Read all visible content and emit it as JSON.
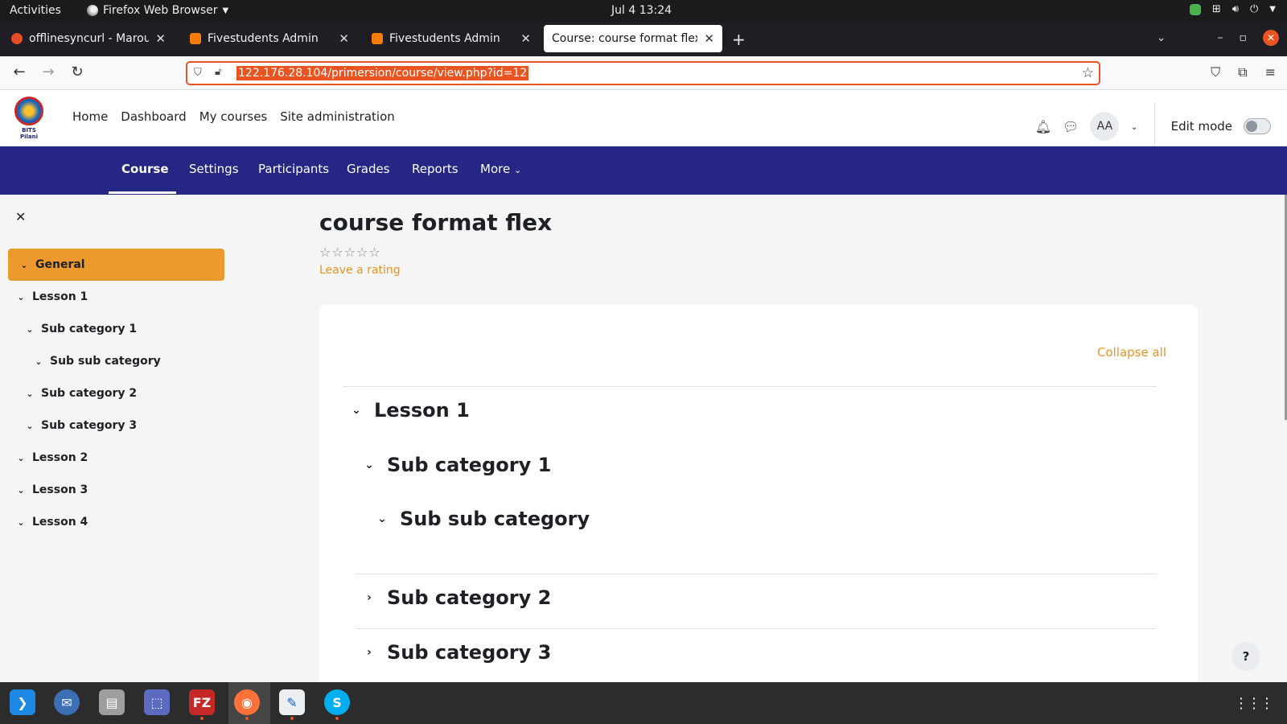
{
  "system": {
    "activities": "Activities",
    "app_name": "Firefox Web Browser",
    "clock": "Jul 4  13:24"
  },
  "browser": {
    "tabs": [
      {
        "label": "offlinesyncurl - Marouane",
        "favicon_color": "#e34c26"
      },
      {
        "label": "Fivestudents Admin",
        "favicon_color": "#f57c00"
      },
      {
        "label": "Fivestudents Admin",
        "favicon_color": "#f57c00"
      },
      {
        "label": "Course: course format flex",
        "favicon_color": "#ffffff"
      }
    ],
    "url": "122.176.28.104/primersion/course/view.php?id=12"
  },
  "moodle": {
    "logo_text": "BITS Pilani",
    "primary_nav": [
      "Home",
      "Dashboard",
      "My courses",
      "Site administration"
    ],
    "avatar_initials": "AA",
    "edit_mode_label": "Edit mode",
    "secondary_nav": [
      "Course",
      "Settings",
      "Participants",
      "Grades",
      "Reports",
      "More"
    ],
    "accent_color": "#ec9a2d",
    "nav_color": "#262685"
  },
  "drawer": {
    "items": [
      {
        "label": "General",
        "active": true
      },
      {
        "label": "Lesson 1"
      },
      {
        "label": "Sub category 1"
      },
      {
        "label": "Sub sub category"
      },
      {
        "label": "Sub category 2"
      },
      {
        "label": "Sub category 3"
      },
      {
        "label": "Lesson 2"
      },
      {
        "label": "Lesson 3"
      },
      {
        "label": "Lesson 4"
      }
    ]
  },
  "course": {
    "title": "course format flex",
    "stars": "☆☆☆☆☆",
    "rating_link": "Leave a rating",
    "collapse_all": "Collapse all",
    "sections": [
      {
        "label": "Lesson 1",
        "expanded": true
      },
      {
        "label": "Sub category 1",
        "expanded": true
      },
      {
        "label": "Sub sub category",
        "expanded": true
      },
      {
        "label": "Sub category 2",
        "expanded": false
      },
      {
        "label": "Sub category 3",
        "expanded": false
      }
    ],
    "help": "?"
  },
  "dock": {
    "apps": [
      {
        "name": "vscode-icon",
        "glyph": "❯",
        "color": "#1e88e5"
      },
      {
        "name": "thunderbird-icon",
        "glyph": "✉",
        "color": "#3d6fb5"
      },
      {
        "name": "files-icon",
        "glyph": "▤",
        "color": "#9e9e9e"
      },
      {
        "name": "screenshot-icon",
        "glyph": "⬚",
        "color": "#5c6bc0"
      },
      {
        "name": "filezilla-icon",
        "glyph": "FZ",
        "color": "#c62828"
      },
      {
        "name": "firefox-icon",
        "glyph": "◉",
        "color": "#ff7139"
      },
      {
        "name": "text-editor-icon",
        "glyph": "✎",
        "color": "#eceff1"
      },
      {
        "name": "skype-icon",
        "glyph": "S",
        "color": "#00aff0"
      }
    ]
  }
}
